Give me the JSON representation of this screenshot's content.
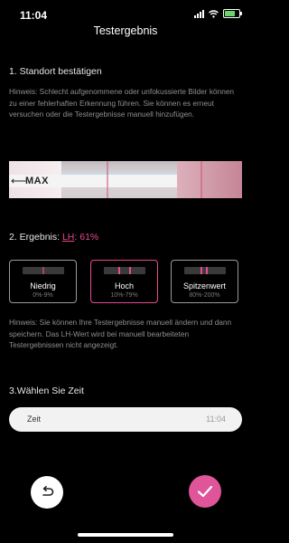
{
  "status": {
    "time": "11:04"
  },
  "header": {
    "title": "Testergebnis"
  },
  "step1": {
    "title": "1. Standort bestätigen",
    "hint": "Hinweis: Schlecht aufgenommene oder unfokussierte Bilder können zu einer fehlerhaften Erkennung führen. Sie können es erneut versuchen oder die Testergebnisse manuell hinzufügen.",
    "strip_text": "MAX"
  },
  "step2": {
    "title_prefix": "2. Ergebnis: ",
    "hormone": "LH",
    "colon": ":",
    "value": "61%",
    "value_percent": 61,
    "options": [
      {
        "name": "Niedrig",
        "range": "0%-9%",
        "selected": false
      },
      {
        "name": "Hoch",
        "range": "10%-79%",
        "selected": true
      },
      {
        "name": "Spitzenwert",
        "range": "80%-200%",
        "selected": false
      }
    ],
    "hint": "Hinweis: Sie können Ihre Testergebnisse manuell ändern und dann speichern. Das LH-Wert wird bei manuell bearbeiteten Testergebnissen nicht angezeigt."
  },
  "step3": {
    "title": "3.Wählen Sie Zeit",
    "field_label": "Zeit",
    "field_value": "11:04"
  },
  "actions": {
    "undo_icon": "undo-icon",
    "confirm_icon": "checkmark-icon"
  },
  "colors": {
    "accent": "#e64a8f",
    "confirm": "#e05599",
    "background": "#000000"
  }
}
